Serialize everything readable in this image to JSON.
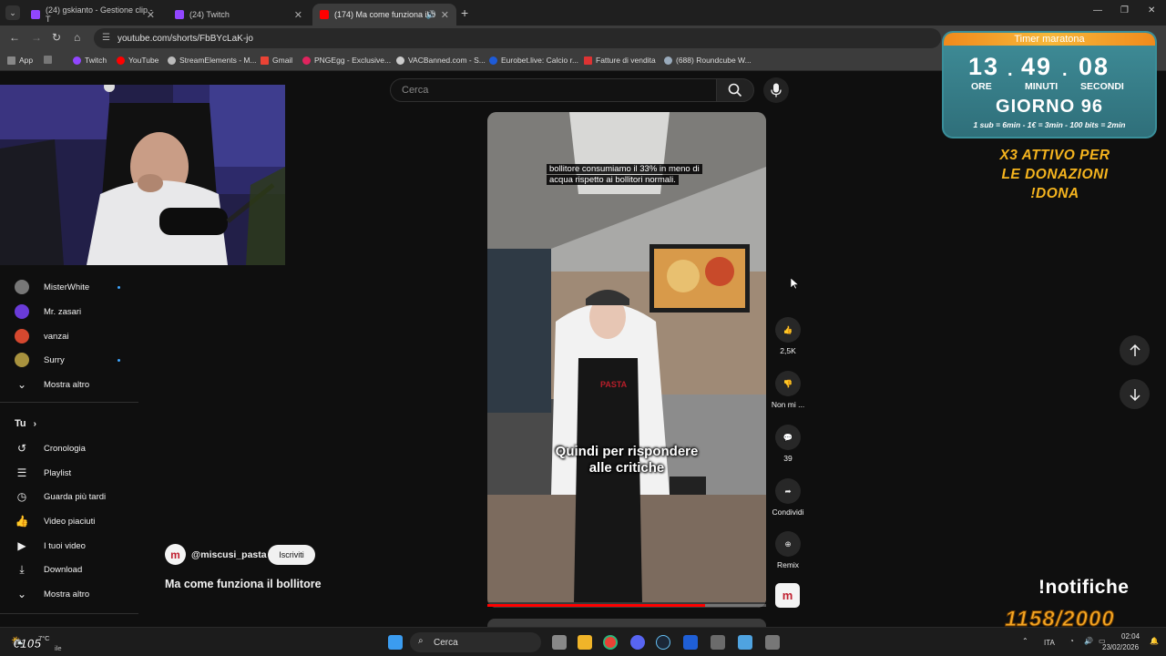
{
  "browser": {
    "tabs": [
      {
        "label": "(24) gskianto - Gestione clip - T",
        "active": false,
        "color": "#9146ff"
      },
      {
        "label": "(24) Twitch",
        "active": false,
        "color": "#9146ff"
      },
      {
        "label": "(174) Ma come funziona il b",
        "active": true,
        "color": "#ff0000"
      }
    ],
    "new_tab": "+",
    "url": "youtube.com/shorts/FbBYcLaK-jo",
    "bookmarks": [
      "App",
      "Twitch",
      "YouTube",
      "StreamElements - M...",
      "Gmail",
      "PNGEgg - Exclusive...",
      "VACBanned.com - S...",
      "Eurobet.live: Calcio r...",
      "Fatture di vendita",
      "(688) Roundcube W..."
    ]
  },
  "youtube": {
    "search_placeholder": "Cerca",
    "sidebar": {
      "subscriptions": [
        {
          "name": "MisterWhite",
          "new": true
        },
        {
          "name": "Mr. zasari",
          "new": false
        },
        {
          "name": "vanzai",
          "new": false
        },
        {
          "name": "Surry",
          "new": true
        }
      ],
      "show_more": "Mostra altro",
      "you_header": "Tu",
      "you_items": [
        "Cronologia",
        "Playlist",
        "Guarda più tardi",
        "Video piaciuti",
        "I tuoi video",
        "Download",
        "Mostra altro"
      ]
    },
    "short": {
      "caption_top_line1": "bollitore consumiamo il 33% in meno di",
      "caption_top_line2": "acqua rispetto ai bollitori normali.",
      "caption_main_line1": "Quindi per rispondere",
      "caption_main_line2": "alle critiche",
      "progress": 0.78,
      "channel": "@miscusi_pasta",
      "subscribe": "Iscriviti",
      "title": "Ma come funziona il bollitore",
      "sign_text": "PASTA"
    },
    "actions": {
      "likes": "2,5K",
      "dislike": "Non mi ...",
      "comments": "39",
      "share": "Condividi",
      "remix": "Remix"
    }
  },
  "overlay": {
    "timer_title": "Timer maratona",
    "hours": "13",
    "minutes": "49",
    "seconds": "08",
    "label_hours": "ORE",
    "label_minutes": "MINUTI",
    "label_seconds": "SECONDI",
    "day": "GIORNO 96",
    "rates": "1 sub = 6min - 1€ = 3min - 100 bits = 2min",
    "x3_line1": "X3 ATTIVO PER",
    "x3_line2": "LE DONAZIONI",
    "x3_line3": "!DONA",
    "notifiche": "!notifiche",
    "counter": "1158/2000",
    "bottom_left": "€105"
  },
  "taskbar": {
    "search": "Cerca",
    "weather_temp": "7°C",
    "weather_sub": "ile",
    "lang": "ITA",
    "time": "02:04",
    "date": "23/02/2026"
  }
}
